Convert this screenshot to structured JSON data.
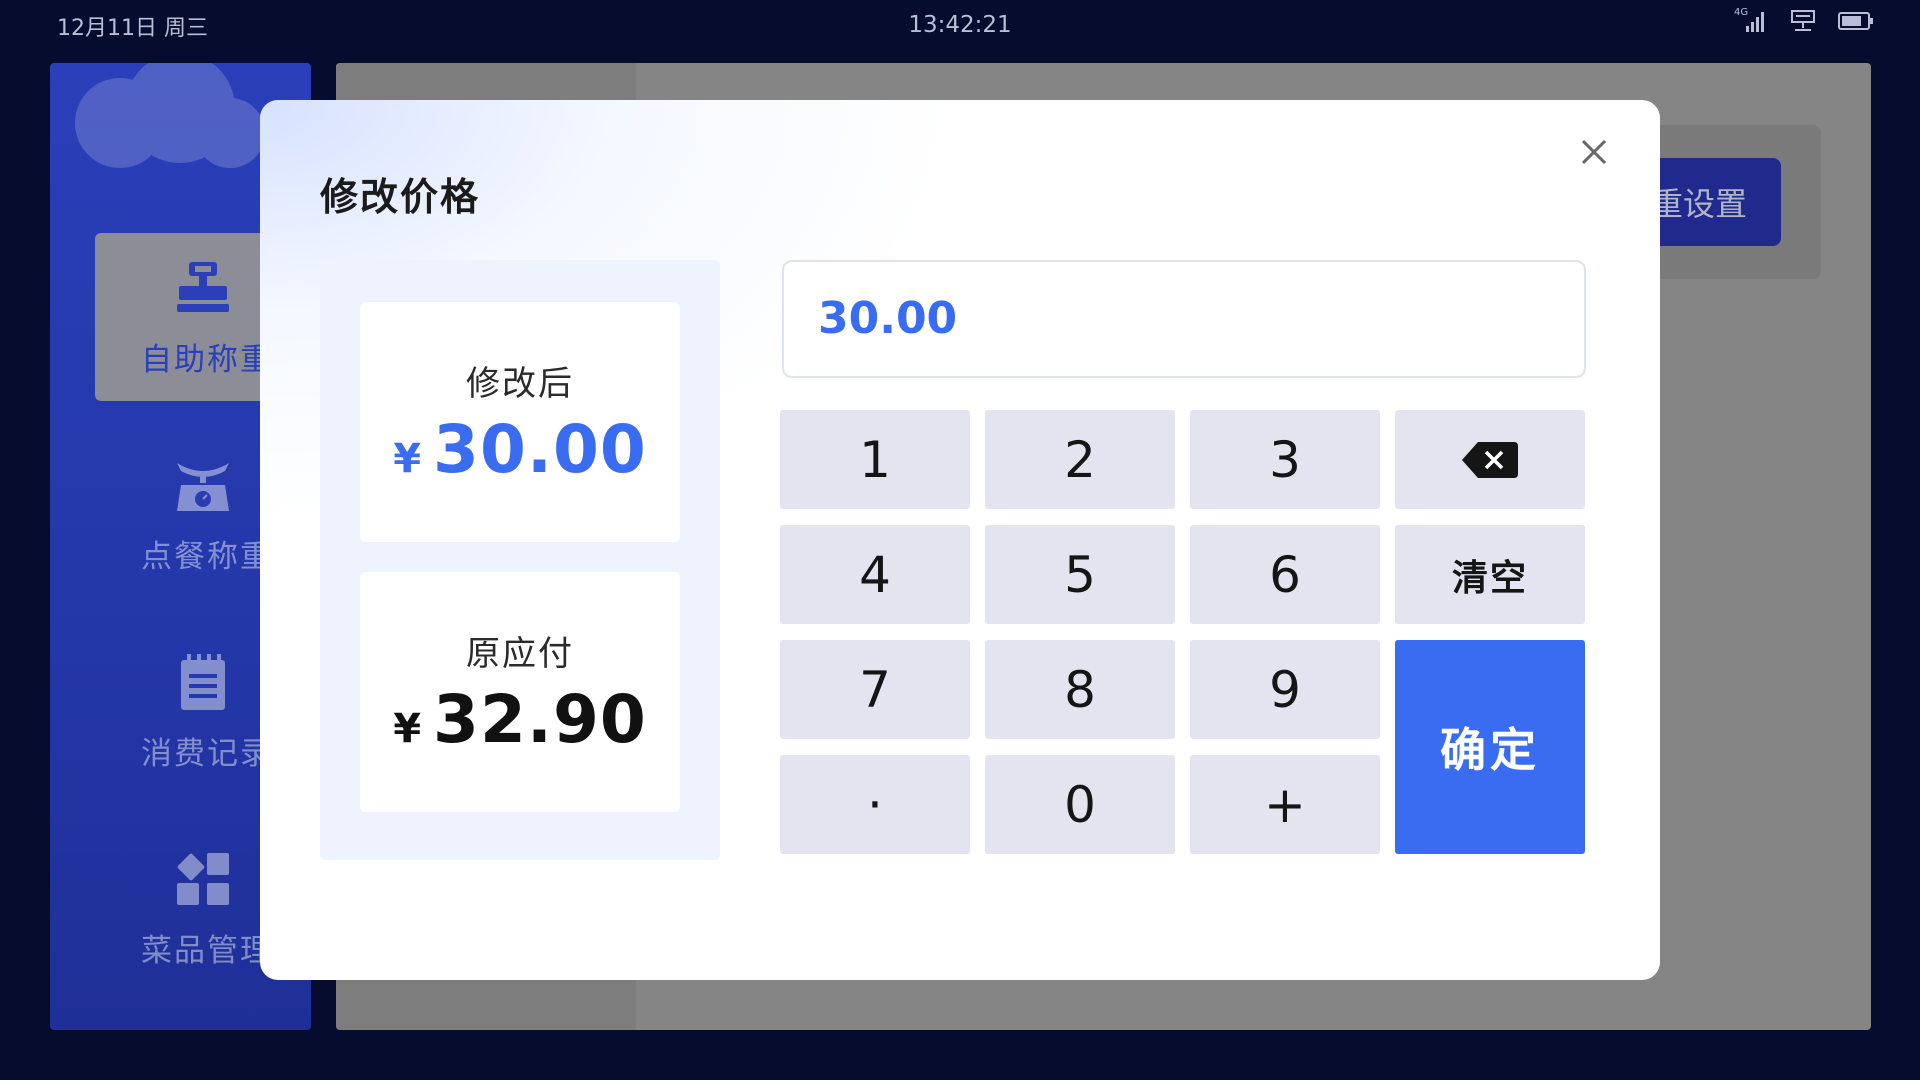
{
  "status_bar": {
    "date": "12月11日 周三",
    "time": "13:42:21",
    "network_label": "4G"
  },
  "sidebar": {
    "items": [
      {
        "label": "自助称重",
        "icon": "cash-register-icon",
        "active": true
      },
      {
        "label": "点餐称重",
        "icon": "scale-icon",
        "active": false
      },
      {
        "label": "消费记录",
        "icon": "notepad-icon",
        "active": false
      },
      {
        "label": "菜品管理",
        "icon": "grid-apps-icon",
        "active": false
      }
    ]
  },
  "background": {
    "setting_button_label": "重设置"
  },
  "dialog": {
    "title": "修改价格",
    "modified": {
      "label": "修改后",
      "currency": "¥",
      "amount": "30.00"
    },
    "original": {
      "label": "原应付",
      "currency": "¥",
      "amount": "32.90"
    },
    "input_value": "30.00",
    "keys": {
      "k1": "1",
      "k2": "2",
      "k3": "3",
      "k4": "4",
      "k5": "5",
      "k6": "6",
      "k7": "7",
      "k8": "8",
      "k9": "9",
      "dot": "·",
      "k0": "0",
      "plus": "+",
      "clear": "清空",
      "confirm": "确定"
    }
  },
  "colors": {
    "accent": "#3a6cf2",
    "background": "#050c2e",
    "sidebar": "#2a3fb9",
    "key": "#e3e4ef"
  }
}
